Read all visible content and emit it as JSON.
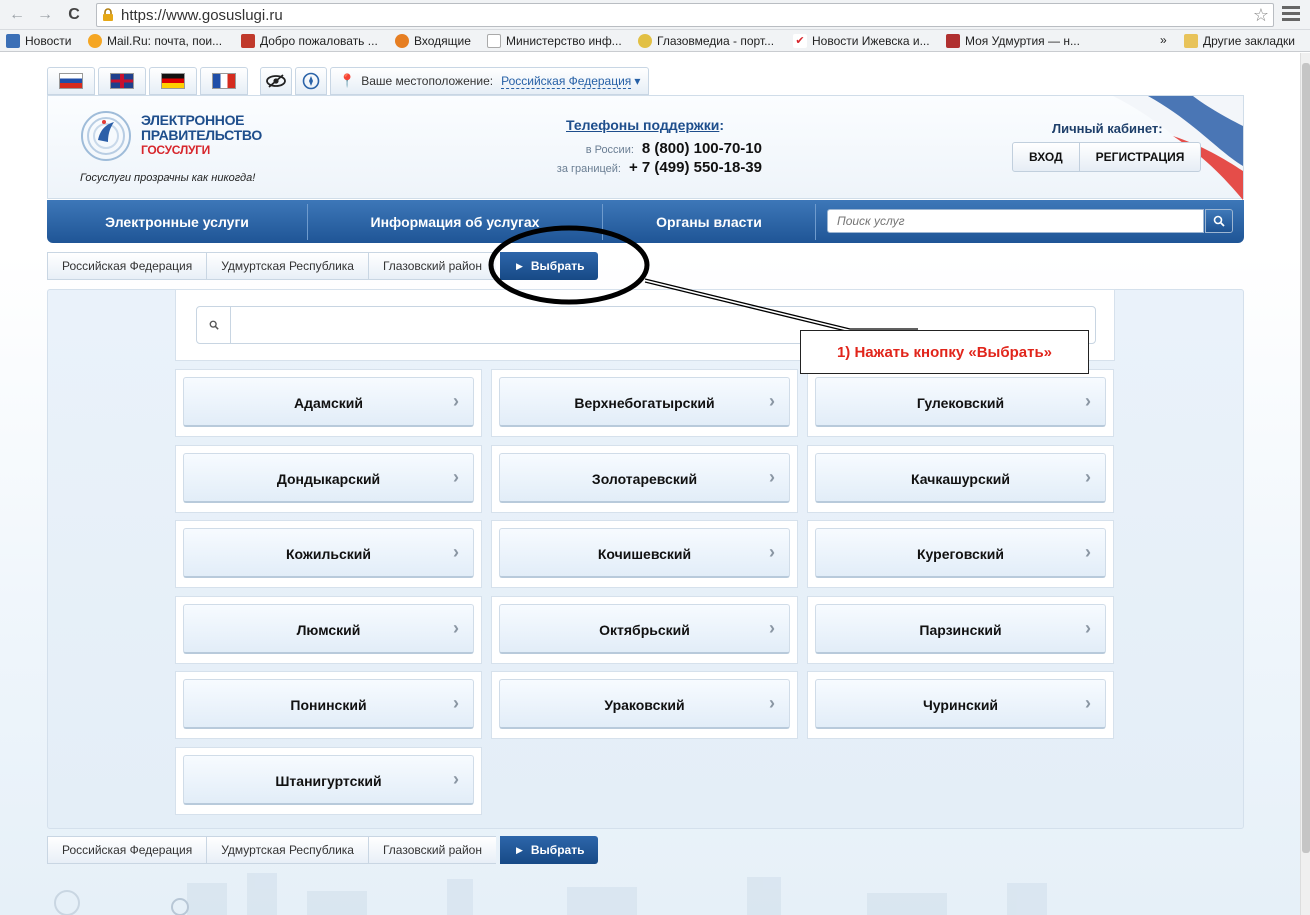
{
  "browser": {
    "url": "https://www.gosuslugi.ru",
    "bookmarks": [
      {
        "label": "Новости",
        "color": "#3b6fb6"
      },
      {
        "label": "Mail.Ru: почта, пои...",
        "color": "#f5a623"
      },
      {
        "label": "Добро пожаловать ...",
        "color": "#c0392b"
      },
      {
        "label": "Входящие",
        "color": "#e67e22"
      },
      {
        "label": "Министерство инф...",
        "color": "#bbbbbb"
      },
      {
        "label": "Глазовмедиа - порт...",
        "color": "#e2c044"
      },
      {
        "label": "Новости Ижевска и...",
        "color": "#d7262c"
      },
      {
        "label": "Моя Удмуртия — н...",
        "color": "#b03030"
      }
    ],
    "more": "»",
    "other_bookmarks": "Другие закладки"
  },
  "header": {
    "location_label": "Ваше местоположение:",
    "location_value": "Российская Федерация",
    "logo_line1": "ЭЛЕКТРОННОЕ",
    "logo_line2": "ПРАВИТЕЛЬСТВО",
    "logo_line3": "ГОСУСЛУГИ",
    "slogan": "Госуслуги прозрачны как никогда!",
    "support_title": "Телефоны поддержки",
    "support_colon": ":",
    "phone_russia_label": "в России:",
    "phone_russia": "8 (800) 100-70-10",
    "phone_abroad_label": "за границей:",
    "phone_abroad": "+ 7 (499) 550-18-39",
    "cabinet_title": "Личный кабинет:",
    "login_label": "ВХОД",
    "register_label": "РЕГИСТРАЦИЯ"
  },
  "nav": {
    "tabs": [
      "Электронные услуги",
      "Информация об услугах",
      "Органы власти"
    ],
    "search_placeholder": "Поиск услуг"
  },
  "breadcrumbs": {
    "items": [
      "Российская Федерация",
      "Удмуртская Республика",
      "Глазовский район"
    ],
    "select_label": "Выбрать"
  },
  "districts": [
    "Адамский",
    "Верхнебогатырский",
    "Гулековский",
    "Дондыкарский",
    "Золотаревский",
    "Качкашурский",
    "Кожильский",
    "Кочишевский",
    "Куреговский",
    "Люмский",
    "Октябрьский",
    "Парзинский",
    "Понинский",
    "Ураковский",
    "Чуринский",
    "Штанигуртский"
  ],
  "annotation": {
    "text": "1) Нажать кнопку «Выбрать»",
    "color": "#e1251b"
  }
}
